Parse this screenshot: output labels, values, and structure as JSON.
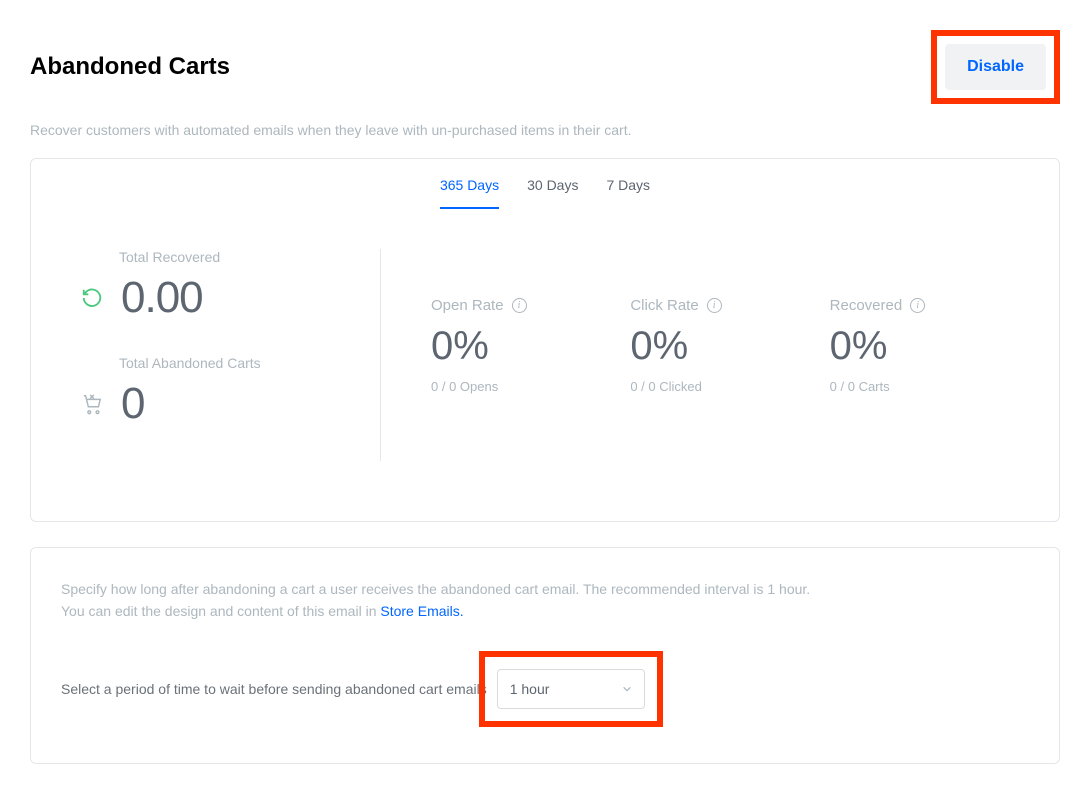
{
  "header": {
    "title": "Abandoned Carts",
    "disable_label": "Disable"
  },
  "subtitle": "Recover customers with automated emails when they leave with un-purchased items in their cart.",
  "tabs": {
    "tab_365": "365 Days",
    "tab_30": "30 Days",
    "tab_7": "7 Days"
  },
  "stats": {
    "total_recovered_label": "Total Recovered",
    "total_recovered_value": "0.00",
    "total_abandoned_label": "Total Abandoned Carts",
    "total_abandoned_value": "0",
    "open_rate_label": "Open Rate",
    "open_rate_value": "0%",
    "open_rate_sub": "0 / 0 Opens",
    "click_rate_label": "Click Rate",
    "click_rate_value": "0%",
    "click_rate_sub": "0 / 0 Clicked",
    "recovered_label": "Recovered",
    "recovered_value": "0%",
    "recovered_sub": "0 / 0 Carts"
  },
  "settings": {
    "line1": "Specify how long after abandoning a cart a user receives the abandoned cart email. The recommended interval is 1 hour.",
    "line2_prefix": "You can edit the design and content of this email in ",
    "line2_link": "Store Emails.",
    "select_label": "Select a period of time to wait before sending abandoned cart emails",
    "select_value": "1 hour"
  }
}
